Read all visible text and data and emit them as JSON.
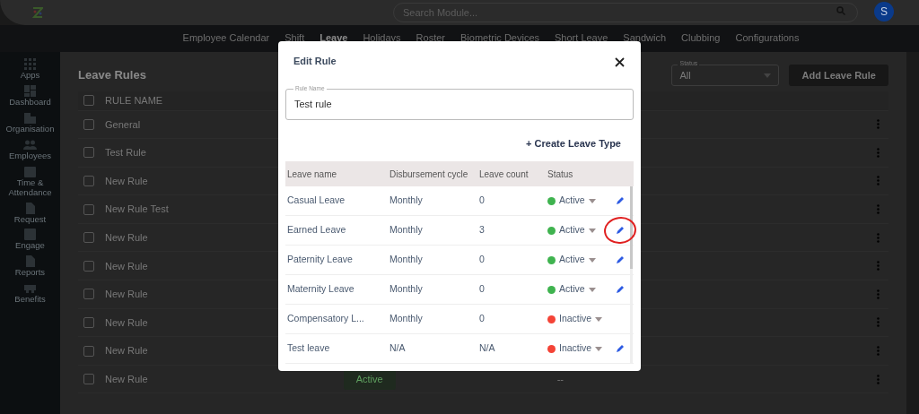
{
  "topbar": {
    "search": {
      "placeholder": "Search Module..."
    },
    "avatar": "S"
  },
  "nav": [
    {
      "label": "Employee Calendar",
      "selected": false
    },
    {
      "label": "Shift",
      "selected": false
    },
    {
      "label": "Leave",
      "selected": true
    },
    {
      "label": "Holidays",
      "selected": false
    },
    {
      "label": "Roster",
      "selected": false
    },
    {
      "label": "Biometric Devices",
      "selected": false
    },
    {
      "label": "Short Leave",
      "selected": false
    },
    {
      "label": "Sandwich",
      "selected": false
    },
    {
      "label": "Clubbing",
      "selected": false
    },
    {
      "label": "Configurations",
      "selected": false
    }
  ],
  "sidebar": {
    "items": [
      {
        "label": "Apps"
      },
      {
        "label": "Dashboard"
      },
      {
        "label": "Organisation"
      },
      {
        "label": "Employees"
      },
      {
        "label": "Time & Attendance"
      },
      {
        "label": "Request"
      },
      {
        "label": "Engage"
      },
      {
        "label": "Reports"
      },
      {
        "label": "Benefits"
      }
    ]
  },
  "page": {
    "title": "Leave Rules",
    "status_filter": {
      "label": "Status",
      "value": "All"
    },
    "add_button": "Add Leave Rule",
    "table": {
      "select_all": {
        "checked": false
      },
      "columns": [
        "RULE NAME"
      ],
      "rows": [
        {
          "name": "General",
          "checked": false
        },
        {
          "name": "Test Rule",
          "checked": false
        },
        {
          "name": "New Rule",
          "checked": false
        },
        {
          "name": "New Rule Test",
          "checked": false
        },
        {
          "name": "New Rule",
          "checked": false
        },
        {
          "name": "New Rule",
          "checked": false
        },
        {
          "name": "New Rule",
          "checked": false
        },
        {
          "name": "New Rule",
          "checked": false
        },
        {
          "name": "New Rule",
          "checked": false
        },
        {
          "name": "New Rule",
          "checked": false,
          "status": "Active",
          "column_3": "--"
        }
      ]
    }
  },
  "modal": {
    "title": "Edit Rule",
    "rule_name": {
      "label": "Rule Name",
      "value": "Test rule"
    },
    "create_link": "+ Create Leave Type",
    "columns": [
      "Leave name",
      "Disbursement cycle",
      "Leave count",
      "Status"
    ],
    "rows": [
      {
        "name": "Casual Leave",
        "cycle": "Monthly",
        "count": "0",
        "status": "Active",
        "color": "#3fb34f",
        "editable": true,
        "annotated": false
      },
      {
        "name": "Earned Leave",
        "cycle": "Monthly",
        "count": "3",
        "status": "Active",
        "color": "#3fb34f",
        "editable": true,
        "annotated": true
      },
      {
        "name": "Paternity Leave",
        "cycle": "Monthly",
        "count": "0",
        "status": "Active",
        "color": "#3fb34f",
        "editable": true,
        "annotated": false
      },
      {
        "name": "Maternity Leave",
        "cycle": "Monthly",
        "count": "0",
        "status": "Active",
        "color": "#3fb34f",
        "editable": true,
        "annotated": false
      },
      {
        "name": "Compensatory L...",
        "cycle": "Monthly",
        "count": "0",
        "status": "Inactive",
        "color": "#f44336",
        "editable": false,
        "annotated": false
      },
      {
        "name": "Test leave",
        "cycle": "N/A",
        "count": "N/A",
        "status": "Inactive",
        "color": "#f44336",
        "editable": true,
        "annotated": false
      }
    ]
  }
}
